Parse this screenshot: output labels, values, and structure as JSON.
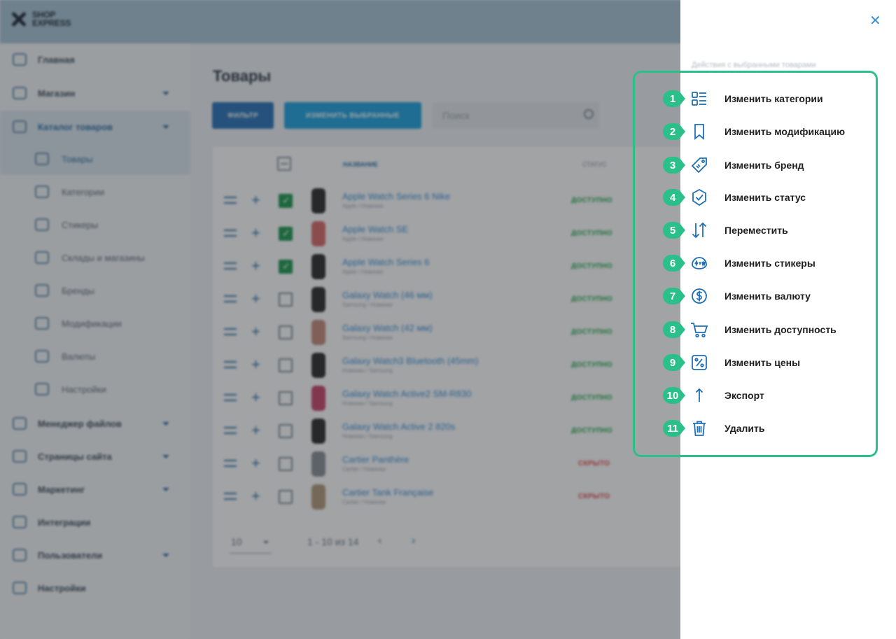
{
  "app": {
    "logo_line1": "SHOP",
    "logo_line2": "EXPRESS",
    "accent": "#2f70a6",
    "highlight": "#2bc08a"
  },
  "sidebar": {
    "items": [
      {
        "label": "Главная",
        "icon": "home-icon"
      },
      {
        "label": "Магазин",
        "icon": "cart-icon"
      },
      {
        "label": "Каталог товаров",
        "icon": "book-icon"
      },
      {
        "label": "Товары",
        "icon": "box-icon"
      },
      {
        "label": "Категории",
        "icon": "categories-icon"
      },
      {
        "label": "Стикеры",
        "icon": "sticker-icon"
      },
      {
        "label": "Склады и магазины",
        "icon": "cube-icon"
      },
      {
        "label": "Бренды",
        "icon": "tag-icon"
      },
      {
        "label": "Модификации",
        "icon": "bookmark-icon"
      },
      {
        "label": "Валюты",
        "icon": "dollar-icon"
      },
      {
        "label": "Настройки",
        "icon": "gear-icon"
      },
      {
        "label": "Менеджер файлов",
        "icon": "folder-icon"
      },
      {
        "label": "Страницы сайта",
        "icon": "pages-icon"
      },
      {
        "label": "Маркетинг",
        "icon": "marketing-icon"
      },
      {
        "label": "Интеграции",
        "icon": "megaphone-icon"
      },
      {
        "label": "Пользователи",
        "icon": "users-icon"
      },
      {
        "label": "Настройки",
        "icon": "gear-icon"
      }
    ]
  },
  "main": {
    "title": "Товары",
    "filter_btn": "ФИЛЬТР",
    "edit_btn": "ИЗМЕНИТЬ ВЫБРАННЫЕ",
    "search_placeholder": "Поиск",
    "col_name": "НАЗВАНИЕ",
    "col_status": "СТАТУС",
    "rows": [
      {
        "name": "Apple Watch Series 6 Nike",
        "sub": "Apple / Новинки",
        "status": "ДОСТУПНО",
        "checked": true
      },
      {
        "name": "Apple Watch SE",
        "sub": "Apple / Новинки",
        "status": "ДОСТУПНО",
        "checked": true
      },
      {
        "name": "Apple Watch Series 6",
        "sub": "Apple / Новинки",
        "status": "ДОСТУПНО",
        "checked": true
      },
      {
        "name": "Galaxy Watch (46 мм)",
        "sub": "Samsung / Новинки",
        "status": "ДОСТУПНО",
        "checked": false
      },
      {
        "name": "Galaxy Watch (42 мм)",
        "sub": "Samsung / Новинки",
        "status": "ДОСТУПНО",
        "checked": false
      },
      {
        "name": "Galaxy Watch3 Bluetooth (45mm)",
        "sub": "Новинки / Samsung",
        "status": "ДОСТУПНО",
        "checked": false
      },
      {
        "name": "Galaxy Watch Active2 SM-R830",
        "sub": "Новинки / Samsung",
        "status": "ДОСТУПНО",
        "checked": false
      },
      {
        "name": "Galaxy Watch Active 2 820s",
        "sub": "Новинки / Samsung",
        "status": "ДОСТУПНО",
        "checked": false
      },
      {
        "name": "Cartier Panthère",
        "sub": "Cartier / Новинки",
        "status": "СКРЫТО",
        "checked": false
      },
      {
        "name": "Cartier Tank Française",
        "sub": "Cartier / Новинки",
        "status": "СКРЫТО",
        "checked": false
      }
    ],
    "pager": {
      "page_size": "10",
      "info": "1 - 10 из 14",
      "prev": "‹",
      "next": "›"
    }
  },
  "drawer": {
    "close": "✕",
    "subtitle": "Действия с выбранными товарами",
    "actions": [
      {
        "num": "1",
        "label": "Изменить категории",
        "icon": "categories-icon"
      },
      {
        "num": "2",
        "label": "Изменить модификацию",
        "icon": "bookmark-icon"
      },
      {
        "num": "3",
        "label": "Изменить бренд",
        "icon": "tag-icon"
      },
      {
        "num": "4",
        "label": "Изменить статус",
        "icon": "status-check-icon"
      },
      {
        "num": "5",
        "label": "Переместить",
        "icon": "move-arrows-icon"
      },
      {
        "num": "6",
        "label": "Изменить стикеры",
        "icon": "sticker-icon"
      },
      {
        "num": "7",
        "label": "Изменить валюту",
        "icon": "dollar-icon"
      },
      {
        "num": "8",
        "label": "Изменить доступность",
        "icon": "cart-icon"
      },
      {
        "num": "9",
        "label": "Изменить цены",
        "icon": "percent-icon"
      },
      {
        "num": "10",
        "label": "Экспорт",
        "icon": "export-arrow-icon"
      },
      {
        "num": "11",
        "label": "Удалить",
        "icon": "trash-icon"
      }
    ]
  }
}
